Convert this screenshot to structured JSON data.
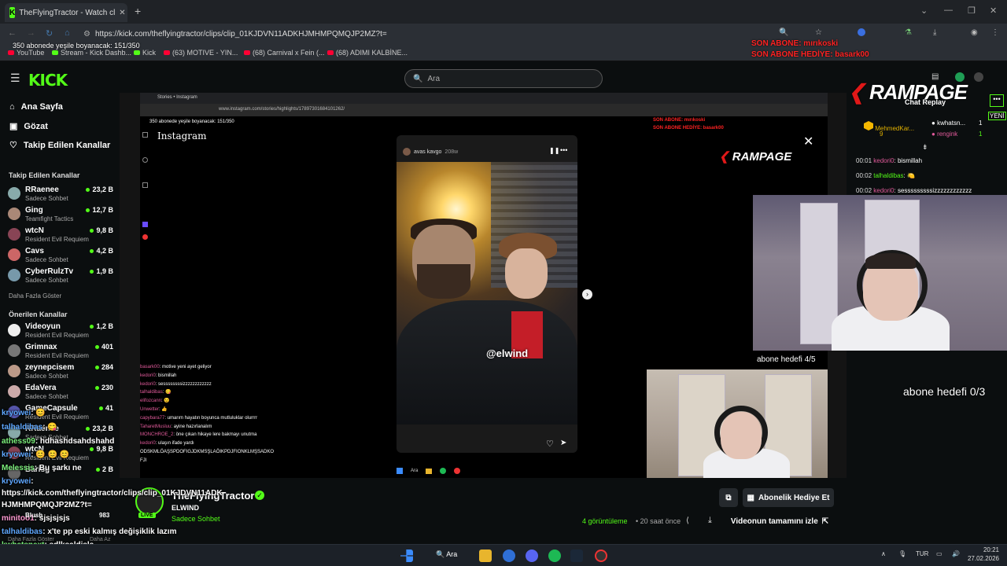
{
  "browser": {
    "tab_title": "TheFlyingTractor - Watch cl",
    "url": "https://kick.com/theflyingtractor/clips/clip_01KJDVN11ADKHJMHMPQMQJP2MZ?t=",
    "new_tab": "+",
    "close_tab": "✕"
  },
  "bookmarks": [
    "YouTube",
    "Stream - Kick Dashb...",
    "Kick",
    "(63) MOTIVE - YIN...",
    "(68) Carnival x Fein (...",
    "(68) ADIMI KALBİNE..."
  ],
  "overlay": {
    "progress_text": "350 abonede yeşile boyanacak: 151/350",
    "son_abone": "SON ABONE: mırıkoski",
    "son_abone_hediye": "SON ABONE HEDİYE: basark00"
  },
  "kick": {
    "logo": "KICK",
    "search_placeholder": "Ara"
  },
  "sidebar": {
    "nav": [
      "Ana Sayfa",
      "Gözat",
      "Takip Edilen Kanallar"
    ],
    "followed_title": "Takip Edilen Kanallar",
    "followed": [
      {
        "name": "RRaenee",
        "sub": "Sadece Sohbet",
        "viewers": "23,2 B",
        "color": "#8aa"
      },
      {
        "name": "Ging",
        "sub": "Teamfight Tactics",
        "viewers": "12,7 B",
        "color": "#a87"
      },
      {
        "name": "wtcN",
        "sub": "Resident Evil Requiem",
        "viewers": "9,8 B",
        "color": "#845"
      },
      {
        "name": "Cavs",
        "sub": "Sadece Sohbet",
        "viewers": "4,2 B",
        "color": "#c66"
      },
      {
        "name": "CyberRulzTv",
        "sub": "Sadece Sohbet",
        "viewers": "1,9 B",
        "color": "#79a"
      }
    ],
    "show_more": "Daha Fazla Göster",
    "recommended_title": "Önerilen Kanallar",
    "recommended": [
      {
        "name": "Videoyun",
        "sub": "Resident Evil Requiem",
        "viewers": "1,2 B",
        "color": "#eee"
      },
      {
        "name": "Grimnax",
        "sub": "Resident Evil Requiem",
        "viewers": "401",
        "color": "#777"
      },
      {
        "name": "zeynepcisem",
        "sub": "Sadece Sohbet",
        "viewers": "284",
        "color": "#b98"
      },
      {
        "name": "EdaVera",
        "sub": "Sadece Sohbet",
        "viewers": "230",
        "color": "#caa"
      },
      {
        "name": "GameCapsule",
        "sub": "Resident Evil Requiem",
        "viewers": "41",
        "color": "#55a"
      },
      {
        "name": "RRaenee",
        "sub": "Sadece Sohbet",
        "viewers": "23,2 B",
        "color": "#8aa"
      },
      {
        "name": "wtcN",
        "sub": "Resident Evil Requiem",
        "viewers": "9,8 B",
        "color": "#845"
      },
      {
        "name": "Barisg",
        "sub": "",
        "viewers": "2 B",
        "color": "#666"
      }
    ]
  },
  "instagram": {
    "tab": "Stories • Instagram",
    "url": "www.instagram.com/stories/highlights/17897301684101262/",
    "logo": "Instagram",
    "story_user": "avas kavgo",
    "story_time": "208w",
    "story_tag": "@elwind",
    "chat": [
      {
        "user": "basark00",
        "msg": ": motive yeni ayet geliyor"
      },
      {
        "user": "kedori0",
        "msg": ": bismillah"
      },
      {
        "user": "kedori0",
        "msg": ": sessssssssizzzzzzzzzzzz"
      },
      {
        "user": "talhaldibas",
        "msg": ": 😋"
      },
      {
        "user": "elifozcann",
        "msg": ": 😉"
      },
      {
        "user": "Unwetter",
        "msg": ": 👍"
      },
      {
        "user": "capybara77",
        "msg": ": umarım hayatın boyunca mutluluklar olurrrr"
      },
      {
        "user": "TaharetMusluu",
        "msg": ": ayine hazırlanalım"
      },
      {
        "user": "MONCHROE_2",
        "msg": ": öne çıkan hikaye lere bakmayı unutma"
      },
      {
        "user": "kedori0",
        "msg": ": ulaşın ifade yardı"
      },
      {
        "user": "",
        "msg": "ODSKMLÖAŞSPDOFIGJDKMSŞLAÖIKPDJFIONKLMŞSADKO"
      },
      {
        "user": "",
        "msg": "FJI"
      }
    ],
    "rampage": "RAMPAGE",
    "inner_search": "Ara"
  },
  "webcam": {
    "goal_top": "abone hedefi 4/5",
    "goal_right": "abone hedefi 0/3"
  },
  "chat_replay": {
    "rampage": "RAMPAGE",
    "title": "Chat Replay",
    "new_badge": "YENİ",
    "pinned": [
      {
        "name": "MehmedKar...",
        "count": "9"
      },
      {
        "name": "kwhatsn...",
        "count": "1"
      },
      {
        "name": "rengink",
        "count": "1"
      }
    ],
    "messages": [
      {
        "time": "00:01",
        "user": "kedori0",
        "msg": ": bismillah"
      },
      {
        "time": "00:02",
        "user": "talhaldibas",
        "msg": ": 🍋"
      },
      {
        "time": "00:02",
        "user": "kedori0",
        "msg": ": sesssssssssizzzzzzzzzzzz"
      }
    ]
  },
  "stream": {
    "channel": "TheFlyingTractor",
    "subtitle": "ELWIND",
    "category": "Sadece Sohbet",
    "live": "LIVE",
    "views": "4 görüntüleme",
    "ago": "• 20 saat önce",
    "gift_button": "Abonelik Hediye Et",
    "full_video_button": "Videonun tamamını izle"
  },
  "overlay_chat": [
    {
      "user": "kryowei",
      "msg": ": 😊",
      "cls": "u1"
    },
    {
      "user": "talhaldibas",
      "msg": ": 😋",
      "cls": "u1"
    },
    {
      "user": "athess09",
      "msg": ": hdhashdsahdshahd",
      "cls": "u2"
    },
    {
      "user": "kryowei",
      "msg": ": 😊 😊 😊",
      "cls": "u1"
    },
    {
      "user": "Melessis",
      "msg": ": Bu şarkı ne",
      "cls": "u2"
    },
    {
      "user": "kryowei",
      "msg": ": ",
      "cls": "u1"
    },
    {
      "user": "",
      "msg": "https://kick.com/theflyingtractor/clips/clip_01KJDVN11ADK",
      "cls": ""
    },
    {
      "user": "",
      "msg": "HJMHMPQMQJP2MZ?t=",
      "cls": ""
    },
    {
      "user": "minitoo1",
      "msg": ": sjsjsjsjs",
      "cls": "u3"
    },
    {
      "user": "talhaldibas",
      "msg": ": x'te pp eski kalmış değişiklik lazım",
      "cls": "u1"
    },
    {
      "user": "kwhatsnext",
      "msg": ": sdlksaldjsla",
      "cls": "u2"
    },
    {
      "user": "kryowei",
      "msg": ": elwind",
      "cls": "u1"
    }
  ],
  "sidebar_extra": {
    "blush": "Blush",
    "blush_viewers": "983",
    "daha_fazla": "Daha Fazla Göster",
    "daha_az": "Daha Az"
  },
  "taskbar": {
    "search": "Ara",
    "lang": "TUR",
    "time": "20:21",
    "date": "27.02.2026"
  }
}
